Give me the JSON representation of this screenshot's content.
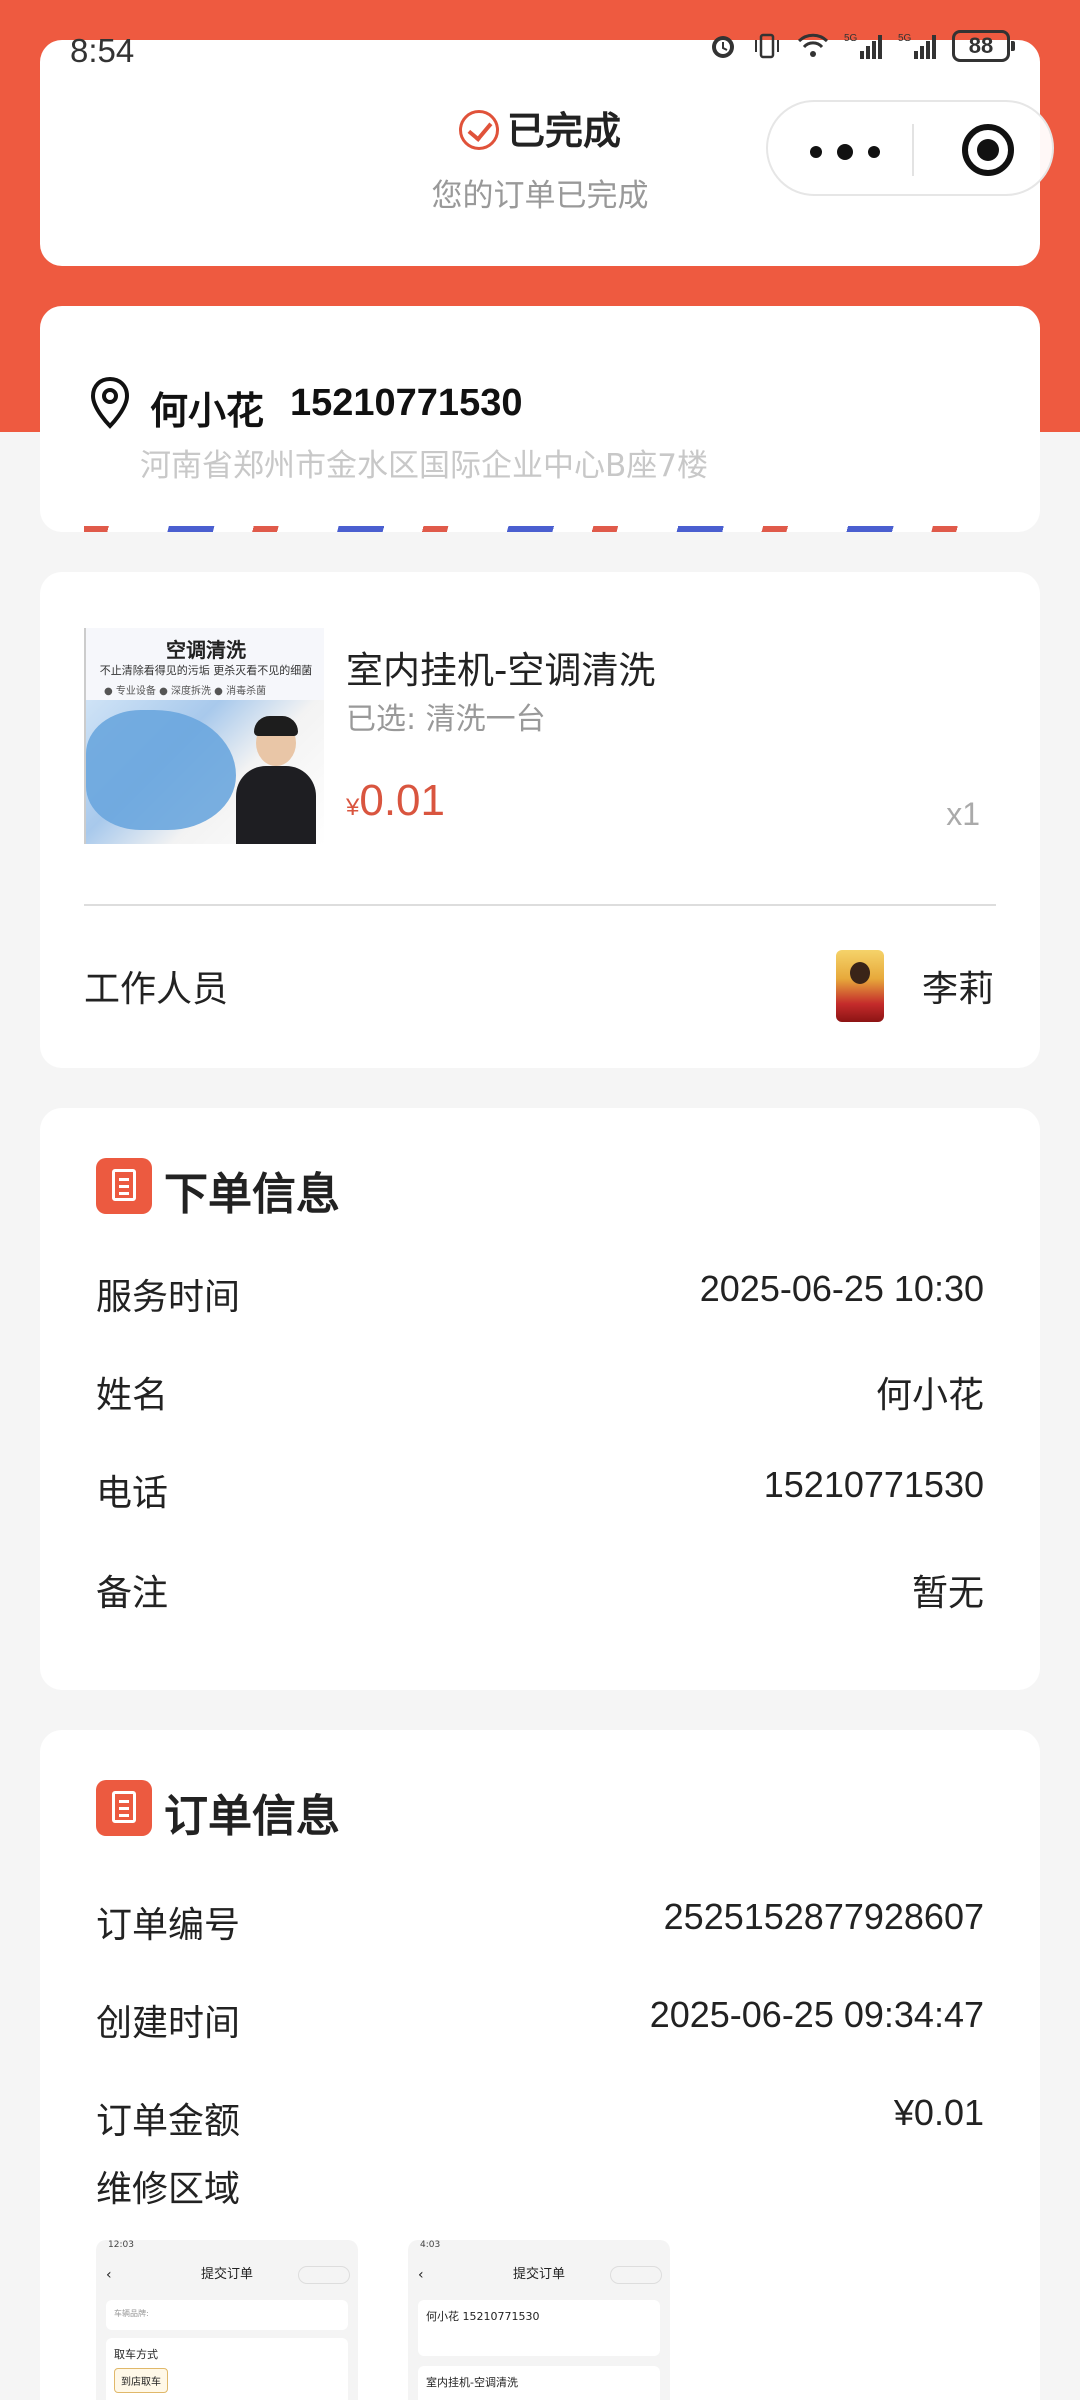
{
  "status_bar": {
    "time": "8:54",
    "battery": "88",
    "network": "5G"
  },
  "status": {
    "title": "已完成",
    "subtitle": "您的订单已完成"
  },
  "address": {
    "name": "何小花",
    "phone": "15210771530",
    "detail": "河南省郑州市金水区国际企业中心B座7楼"
  },
  "product": {
    "image_title": "空调清洗",
    "image_subtitle": "不止清除看得见的污垢 更杀灭看不见的细菌",
    "image_tags": "● 专业设备   ● 深度拆洗   ● 消毒杀菌",
    "name": "室内挂机-空调清洗",
    "selected": "已选: 清洗一台",
    "currency": "¥",
    "price": "0.01",
    "qty": "x1"
  },
  "staff": {
    "label": "工作人员",
    "name": "李莉"
  },
  "order_section": {
    "title": "下单信息",
    "rows": [
      {
        "k": "服务时间",
        "v": "2025-06-25 10:30"
      },
      {
        "k": "姓名",
        "v": "何小花"
      },
      {
        "k": "电话",
        "v": "15210771530"
      },
      {
        "k": "备注",
        "v": "暂无"
      }
    ]
  },
  "order_info": {
    "title": "订单信息",
    "rows": [
      {
        "k": "订单编号",
        "v": "2525152877928607"
      },
      {
        "k": "创建时间",
        "v": "2025-06-25 09:34:47"
      },
      {
        "k": "订单金额",
        "v": "¥0.01"
      }
    ],
    "region_label": "维修区域",
    "thumbs": [
      {
        "time": "12:03",
        "title": "提交订单",
        "box1": "车辆品牌:",
        "box2": "取车方式",
        "tag": "到店取车"
      },
      {
        "time": "4:03",
        "title": "提交订单",
        "box1": "何小花 15210771530",
        "box2": "室内挂机-空调清洗",
        "tag": ""
      }
    ]
  },
  "colors": {
    "brand": "#ee5a40",
    "price": "#d9553f"
  }
}
